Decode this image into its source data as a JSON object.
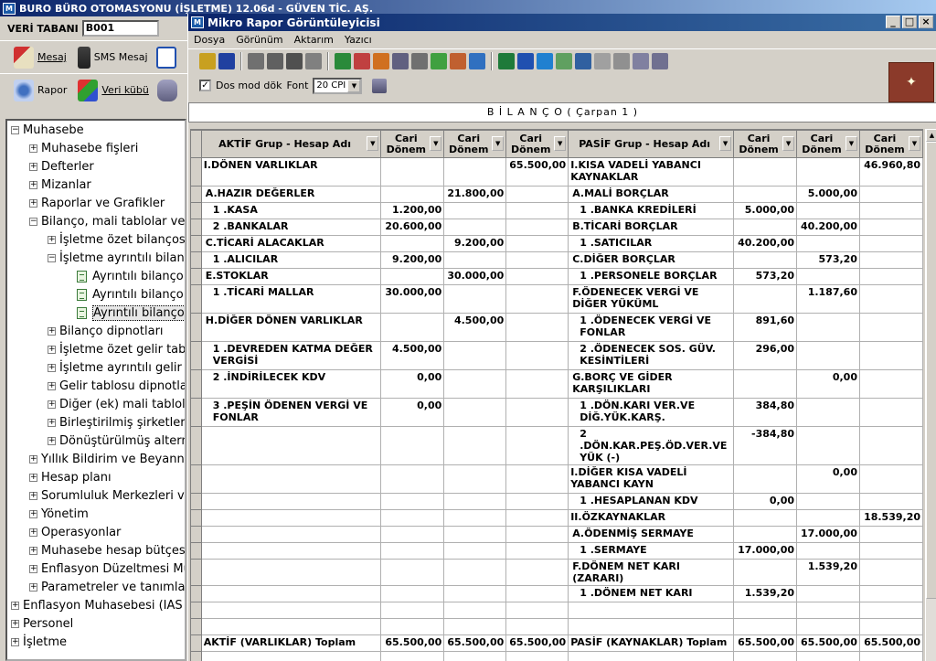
{
  "app": {
    "title": "BURO BÜRO OTOMASYONU (İŞLETME) 12.06d - GÜVEN TİC. AŞ.",
    "logo": "M",
    "db_label": "VERİ TABANI",
    "db_value": "B001"
  },
  "left_toolbar": {
    "row1": [
      {
        "label": "Mesaj",
        "icon": "mail-icon"
      },
      {
        "label": "SMS Mesaj",
        "icon": "phone-icon"
      }
    ],
    "row2": [
      {
        "label": "Rapor",
        "icon": "report-icon"
      },
      {
        "label": "Veri kübü",
        "icon": "cube-icon"
      }
    ]
  },
  "tree": [
    {
      "label": "Muhasebe",
      "level": 0,
      "type": "minus"
    },
    {
      "label": "Muhasebe fişleri",
      "level": 1,
      "type": "plus"
    },
    {
      "label": "Defterler",
      "level": 1,
      "type": "plus"
    },
    {
      "label": "Mizanlar",
      "level": 1,
      "type": "plus"
    },
    {
      "label": "Raporlar ve Grafikler",
      "level": 1,
      "type": "plus"
    },
    {
      "label": "Bilanço, mali tablolar ve",
      "level": 1,
      "type": "minus"
    },
    {
      "label": "İşletme özet bilanços",
      "level": 2,
      "type": "plus"
    },
    {
      "label": "İşletme ayrıntılı bilanc",
      "level": 2,
      "type": "minus"
    },
    {
      "label": "Ayrıntılı bilanço",
      "level": 3,
      "type": "doc"
    },
    {
      "label": "Ayrıntılı bilanço",
      "level": 3,
      "type": "doc"
    },
    {
      "label": "Ayrıntılı bilanço",
      "level": 3,
      "type": "doc",
      "selected": true
    },
    {
      "label": "Bilanço dipnotları",
      "level": 2,
      "type": "plus"
    },
    {
      "label": "İşletme özet gelir tab",
      "level": 2,
      "type": "plus"
    },
    {
      "label": "İşletme ayrıntılı gelir",
      "level": 2,
      "type": "plus"
    },
    {
      "label": "Gelir tablosu dipnotla",
      "level": 2,
      "type": "plus"
    },
    {
      "label": "Diğer (ek) mali tablola",
      "level": 2,
      "type": "plus"
    },
    {
      "label": "Birleştirilmiş şirketler",
      "level": 2,
      "type": "plus"
    },
    {
      "label": "Dönüştürülmüş altern",
      "level": 2,
      "type": "plus"
    },
    {
      "label": "Yıllık Bildirim ve Beyanna",
      "level": 1,
      "type": "plus"
    },
    {
      "label": "Hesap planı",
      "level": 1,
      "type": "plus"
    },
    {
      "label": "Sorumluluk Merkezleri ve",
      "level": 1,
      "type": "plus"
    },
    {
      "label": "Yönetim",
      "level": 1,
      "type": "plus"
    },
    {
      "label": "Operasyonlar",
      "level": 1,
      "type": "plus"
    },
    {
      "label": "Muhasebe hesap bütçes",
      "level": 1,
      "type": "plus"
    },
    {
      "label": "Enflasyon Düzeltmesi Mu",
      "level": 1,
      "type": "plus"
    },
    {
      "label": "Parametreler ve tanımla",
      "level": 1,
      "type": "plus"
    },
    {
      "label": "Enflasyon Muhasebesi (IAS",
      "level": 0,
      "type": "plus"
    },
    {
      "label": "Personel",
      "level": 0,
      "type": "plus"
    },
    {
      "label": "İşletme",
      "level": 0,
      "type": "plus"
    }
  ],
  "report_window": {
    "title": "Mikro Rapor Görüntüleyicisi",
    "menu": [
      "Dosya",
      "Görünüm",
      "Aktarım",
      "Yazıcı"
    ],
    "dos_label": "Dos mod dök",
    "font_label": "Font",
    "font_value": "20 CPI",
    "report_title": "B İ L A N Ç O  ( Çarpan 1 )"
  },
  "toolbar_icons": [
    {
      "name": "open-icon",
      "color": "#c8a020"
    },
    {
      "name": "save-icon",
      "color": "#2040a0"
    },
    {
      "name": "sep"
    },
    {
      "name": "print-icon",
      "color": "#707070"
    },
    {
      "name": "print-preview-icon",
      "color": "#606060"
    },
    {
      "name": "printer-setup-icon",
      "color": "#505050"
    },
    {
      "name": "printer-icon",
      "color": "#808080"
    },
    {
      "name": "sep"
    },
    {
      "name": "add-icon",
      "color": "#2a8a3a"
    },
    {
      "name": "columns-icon",
      "color": "#c04040"
    },
    {
      "name": "table-icon",
      "color": "#d07020"
    },
    {
      "name": "tree-icon",
      "color": "#606080"
    },
    {
      "name": "list-icon",
      "color": "#707070"
    },
    {
      "name": "edit-icon",
      "color": "#40a040"
    },
    {
      "name": "grid-icon",
      "color": "#c06030"
    },
    {
      "name": "refresh-icon",
      "color": "#3070c0"
    },
    {
      "name": "sep"
    },
    {
      "name": "excel-icon",
      "color": "#1e7a3a"
    },
    {
      "name": "word-icon",
      "color": "#2050b0"
    },
    {
      "name": "ie-icon",
      "color": "#2080d0"
    },
    {
      "name": "notepad-icon",
      "color": "#60a060"
    },
    {
      "name": "globe-icon",
      "color": "#3060a0"
    },
    {
      "name": "email-icon",
      "color": "#a0a0a0"
    },
    {
      "name": "document-icon",
      "color": "#909090"
    },
    {
      "name": "text-icon",
      "color": "#8080a0"
    },
    {
      "name": "search-icon",
      "color": "#707090"
    }
  ],
  "grid": {
    "headers": [
      "AKTİF Grup - Hesap Adı",
      "Cari Dönem",
      "Cari Dönem",
      "Cari Dönem",
      "PASİF Grup - Hesap Adı",
      "Cari Dönem",
      "Cari Dönem",
      "Cari Dönem"
    ],
    "rows": [
      {
        "h": 31,
        "cells": [
          "I.DÖNEN VARLIKLAR",
          "",
          "",
          "65.500,00",
          "I.KISA VADELİ YABANCI KAYNAKLAR",
          "",
          "",
          "46.960,80"
        ]
      },
      {
        "h": 18,
        "cells": [
          "A.HAZIR DEĞERLER",
          "",
          "21.800,00",
          "",
          "A.MALİ BORÇLAR",
          "",
          "5.000,00",
          ""
        ]
      },
      {
        "h": 18,
        "cells": [
          "1 .KASA",
          "1.200,00",
          "",
          "",
          "1 .BANKA KREDİLERİ",
          "5.000,00",
          "",
          ""
        ]
      },
      {
        "h": 18,
        "cells": [
          "2 .BANKALAR",
          "20.600,00",
          "",
          "",
          "B.TİCARİ BORÇLAR",
          "",
          "40.200,00",
          ""
        ]
      },
      {
        "h": 18,
        "cells": [
          "C.TİCARİ ALACAKLAR",
          "",
          "9.200,00",
          "",
          "1 .SATICILAR",
          "40.200,00",
          "",
          ""
        ]
      },
      {
        "h": 18,
        "cells": [
          "1 .ALICILAR",
          "9.200,00",
          "",
          "",
          "C.DİĞER BORÇLAR",
          "",
          "573,20",
          ""
        ]
      },
      {
        "h": 18,
        "cells": [
          "E.STOKLAR",
          "",
          "30.000,00",
          "",
          "1 .PERSONELE BORÇLAR",
          "573,20",
          "",
          ""
        ]
      },
      {
        "h": 31,
        "cells": [
          "1 .TİCARİ MALLAR",
          "30.000,00",
          "",
          "",
          "F.ÖDENECEK VERGİ VE DİĞER YÜKÜML",
          "",
          "1.187,60",
          ""
        ]
      },
      {
        "h": 31,
        "cells": [
          "H.DİĞER DÖNEN VARLIKLAR",
          "",
          "4.500,00",
          "",
          "1 .ÖDENECEK VERGİ VE FONLAR",
          "891,60",
          "",
          ""
        ]
      },
      {
        "h": 31,
        "cells": [
          "1 .DEVREDEN KATMA DEĞER VERGİSİ",
          "4.500,00",
          "",
          "",
          "2 .ÖDENECEK SOS. GÜV. KESİNTİLERİ",
          "296,00",
          "",
          ""
        ]
      },
      {
        "h": 31,
        "cells": [
          "2 .İNDİRİLECEK KDV",
          "0,00",
          "",
          "",
          "G.BORÇ VE GİDER KARŞILIKLARI",
          "",
          "0,00",
          ""
        ]
      },
      {
        "h": 31,
        "cells": [
          "3 .PEŞİN ÖDENEN VERGİ VE FONLAR",
          "0,00",
          "",
          "",
          "1 .DÖN.KARI VER.VE DİĞ.YÜK.KARŞ.",
          "384,80",
          "",
          ""
        ]
      },
      {
        "h": 31,
        "cells": [
          "",
          "",
          "",
          "",
          "2 .DÖN.KAR.PEŞ.ÖD.VER.VE YÜK (-)",
          "-384,80",
          "",
          ""
        ]
      },
      {
        "h": 31,
        "cells": [
          "",
          "",
          "",
          "",
          "I.DİĞER KISA VADELİ YABANCI KAYN",
          "",
          "0,00",
          ""
        ]
      },
      {
        "h": 18,
        "cells": [
          "",
          "",
          "",
          "",
          "1 .HESAPLANAN KDV",
          "0,00",
          "",
          ""
        ]
      },
      {
        "h": 18,
        "cells": [
          "",
          "",
          "",
          "",
          "II.ÖZKAYNAKLAR",
          "",
          "",
          "18.539,20"
        ]
      },
      {
        "h": 18,
        "cells": [
          "",
          "",
          "",
          "",
          "A.ÖDENMİŞ SERMAYE",
          "",
          "17.000,00",
          ""
        ]
      },
      {
        "h": 18,
        "cells": [
          "",
          "",
          "",
          "",
          "1 .SERMAYE",
          "17.000,00",
          "",
          ""
        ]
      },
      {
        "h": 18,
        "cells": [
          "",
          "",
          "",
          "",
          "F.DÖNEM NET KARI (ZARARI)",
          "",
          "1.539,20",
          ""
        ]
      },
      {
        "h": 18,
        "cells": [
          "",
          "",
          "",
          "",
          "1 .DÖNEM NET KARI",
          "1.539,20",
          "",
          ""
        ]
      },
      {
        "h": 18,
        "cells": [
          "",
          "",
          "",
          "",
          "",
          "",
          "",
          ""
        ]
      },
      {
        "h": 18,
        "cells": [
          "",
          "",
          "",
          "",
          "",
          "",
          "",
          ""
        ]
      },
      {
        "h": 18,
        "cells": [
          "AKTİF (VARLIKLAR) Toplam",
          "65.500,00",
          "65.500,00",
          "65.500,00",
          "PASİF (KAYNAKLAR) Toplam",
          "65.500,00",
          "65.500,00",
          "65.500,00"
        ]
      },
      {
        "h": 18,
        "cells": [
          "",
          "",
          "",
          "",
          "",
          "",
          "",
          ""
        ]
      }
    ]
  }
}
